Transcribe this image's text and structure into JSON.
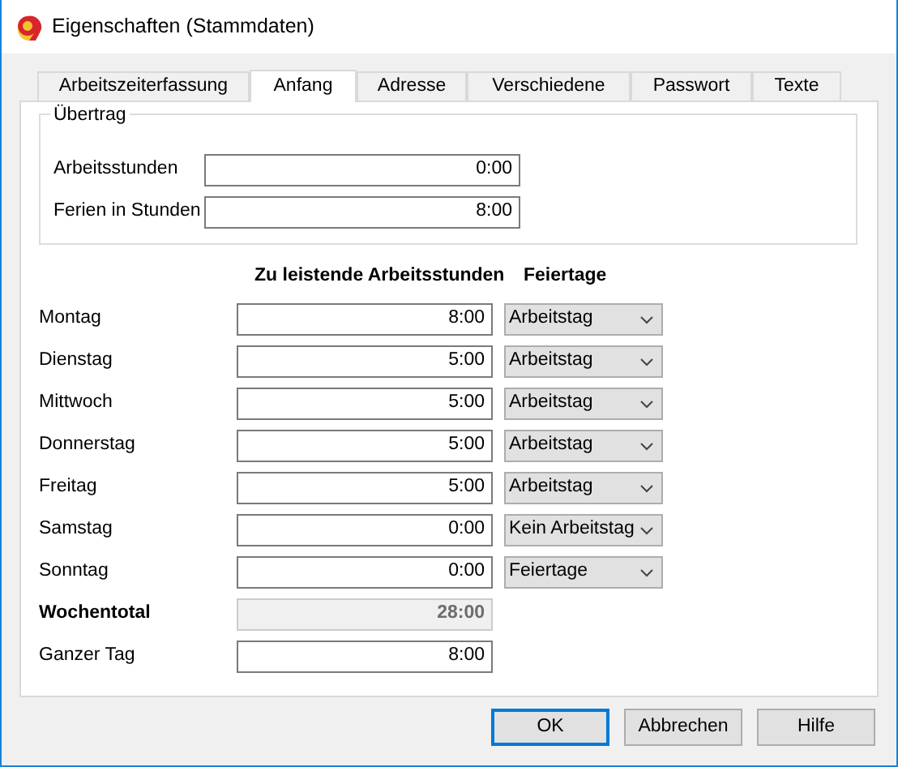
{
  "window": {
    "title": "Eigenschaften (Stammdaten)"
  },
  "tabs": [
    {
      "label": "Arbeitszeiterfassung",
      "selected": false
    },
    {
      "label": "Anfang",
      "selected": true
    },
    {
      "label": "Adresse",
      "selected": false
    },
    {
      "label": "Verschiedene",
      "selected": false
    },
    {
      "label": "Passwort",
      "selected": false
    },
    {
      "label": "Texte",
      "selected": false
    }
  ],
  "carryover": {
    "title": "Übertrag",
    "fields": [
      {
        "label": "Arbeitsstunden",
        "value": "0:00"
      },
      {
        "label": "Ferien in Stunden",
        "value": "8:00"
      }
    ]
  },
  "schedule": {
    "hours_heading": "Zu leistende Arbeitsstunden",
    "holidays_heading": "Feiertage",
    "days": [
      {
        "label": "Montag",
        "hours": "8:00",
        "holiday": "Arbeitstag"
      },
      {
        "label": "Dienstag",
        "hours": "5:00",
        "holiday": "Arbeitstag"
      },
      {
        "label": "Mittwoch",
        "hours": "5:00",
        "holiday": "Arbeitstag"
      },
      {
        "label": "Donnerstag",
        "hours": "5:00",
        "holiday": "Arbeitstag"
      },
      {
        "label": "Freitag",
        "hours": "5:00",
        "holiday": "Arbeitstag"
      },
      {
        "label": "Samstag",
        "hours": "0:00",
        "holiday": "Kein Arbeitstag"
      },
      {
        "label": "Sonntag",
        "hours": "0:00",
        "holiday": "Feiertage"
      }
    ],
    "total": {
      "label": "Wochentotal",
      "value": "28:00",
      "disabled": true
    },
    "full_day": {
      "label": "Ganzer Tag",
      "value": "8:00"
    }
  },
  "buttons": [
    {
      "label": "OK",
      "default": true
    },
    {
      "label": "Abbrechen",
      "default": false
    },
    {
      "label": "Hilfe",
      "default": false
    }
  ]
}
